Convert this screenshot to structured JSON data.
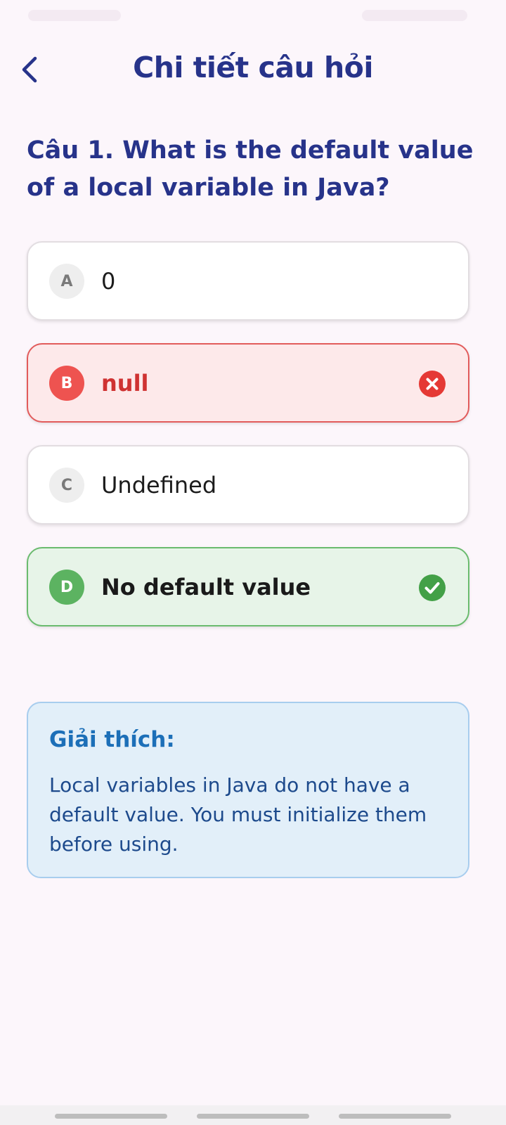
{
  "header": {
    "title": "Chi tiết câu hỏi"
  },
  "question": {
    "text": "Câu 1. What is the default value of a local variable in Java?"
  },
  "options": [
    {
      "letter": "A",
      "text": "0",
      "state": "normal"
    },
    {
      "letter": "B",
      "text": "null",
      "state": "wrong"
    },
    {
      "letter": "C",
      "text": "Undefined",
      "state": "normal"
    },
    {
      "letter": "D",
      "text": "No default value",
      "state": "correct"
    }
  ],
  "explanation": {
    "title": "Giải thích:",
    "text": "Local variables in Java do not have a default value. You must initialize them before using."
  },
  "colors": {
    "primary": "#27338a",
    "wrong": "#ee5350",
    "correct": "#5cb361",
    "explain_bg": "#e2eff9"
  },
  "icons": {
    "back": "chevron-left-icon",
    "wrong": "x-circle-icon",
    "correct": "check-circle-icon"
  }
}
